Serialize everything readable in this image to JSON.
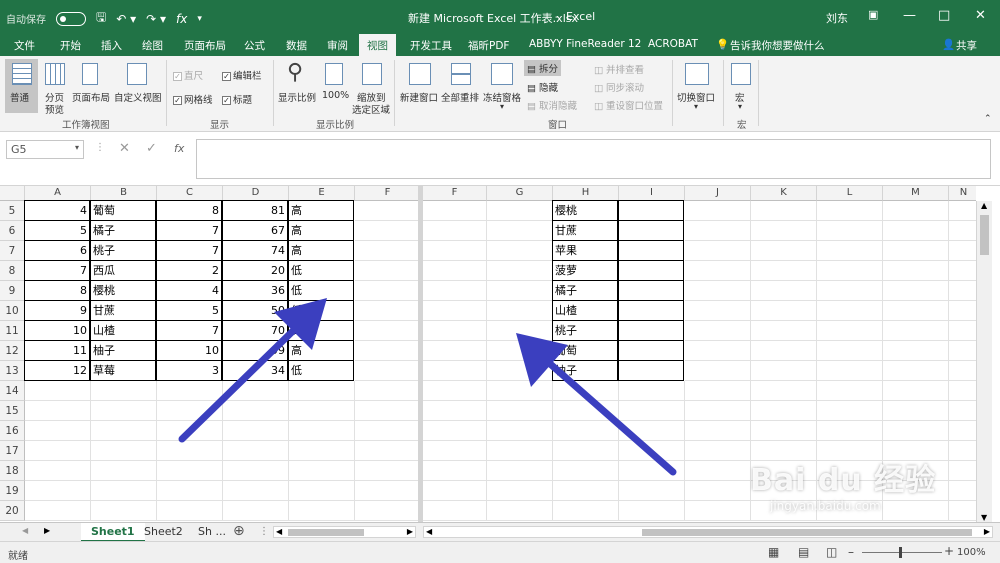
{
  "titlebar": {
    "autosave": "自动保存",
    "filename": "新建 Microsoft Excel 工作表.xlsx",
    "app": "Excel",
    "user": "刘东"
  },
  "tabs": [
    "文件",
    "开始",
    "插入",
    "绘图",
    "页面布局",
    "公式",
    "数据",
    "审阅",
    "视图",
    "开发工具",
    "福昕PDF",
    "ABBYY FineReader 12",
    "ACROBAT",
    "告诉我你想要做什么",
    "共享"
  ],
  "active_tab": "视图",
  "ribbon": {
    "workbook_views": {
      "normal": "普通",
      "page_break": "分页",
      "page_break2": "预览",
      "page_layout": "页面布局",
      "custom": "自定义视图",
      "group": "工作簿视图"
    },
    "show": {
      "ruler": "直尺",
      "formula_bar": "编辑栏",
      "gridlines": "网格线",
      "headings": "标题",
      "group": "显示"
    },
    "zoom": {
      "zoom": "显示比例",
      "hundred": "100%",
      "zoom_sel": "缩放到",
      "zoom_sel2": "选定区域",
      "group": "显示比例"
    },
    "window": {
      "new_window": "新建窗口",
      "arrange_all": "全部重排",
      "freeze": "冻结窗格",
      "split": "拆分",
      "hide": "隐藏",
      "unhide": "取消隐藏",
      "side_by_side": "并排查看",
      "sync_scroll": "同步滚动",
      "reset_pos": "重设窗口位置",
      "switch": "切换窗口",
      "group": "窗口"
    },
    "macros": {
      "macros": "宏",
      "group": "宏"
    }
  },
  "namebox": "G5",
  "left_pane": {
    "columns": [
      "A",
      "B",
      "C",
      "D",
      "E",
      "F"
    ],
    "rows": [
      {
        "n": "5",
        "a": "4",
        "b": "葡萄",
        "c": "8",
        "d": "81",
        "e": "高"
      },
      {
        "n": "6",
        "a": "5",
        "b": "橘子",
        "c": "7",
        "d": "67",
        "e": "高"
      },
      {
        "n": "7",
        "a": "6",
        "b": "桃子",
        "c": "7",
        "d": "74",
        "e": "高"
      },
      {
        "n": "8",
        "a": "7",
        "b": "西瓜",
        "c": "2",
        "d": "20",
        "e": "低"
      },
      {
        "n": "9",
        "a": "8",
        "b": "樱桃",
        "c": "4",
        "d": "36",
        "e": "低"
      },
      {
        "n": "10",
        "a": "9",
        "b": "甘蔗",
        "c": "5",
        "d": "50",
        "e": "低"
      },
      {
        "n": "11",
        "a": "10",
        "b": "山楂",
        "c": "7",
        "d": "70",
        "e": "高"
      },
      {
        "n": "12",
        "a": "11",
        "b": "柚子",
        "c": "10",
        "d": "99",
        "e": "高"
      },
      {
        "n": "13",
        "a": "12",
        "b": "草莓",
        "c": "3",
        "d": "34",
        "e": "低"
      },
      {
        "n": "14"
      },
      {
        "n": "15"
      },
      {
        "n": "16"
      },
      {
        "n": "17"
      },
      {
        "n": "18"
      },
      {
        "n": "19"
      },
      {
        "n": "20"
      }
    ]
  },
  "right_pane": {
    "columns": [
      "F",
      "G",
      "H",
      "I",
      "J",
      "K",
      "L",
      "M",
      "N"
    ],
    "h_values": [
      "樱桃",
      "甘蔗",
      "苹果",
      "菠萝",
      "橘子",
      "山楂",
      "桃子",
      "葡萄",
      "柚子"
    ]
  },
  "sheets": [
    "Sheet1",
    "Sheet2",
    "Sh ..."
  ],
  "status": {
    "ready": "就绪",
    "zoom": "100%"
  },
  "watermark": {
    "logo": "Bai du 经验",
    "url": "jingyan.baidu.com"
  },
  "colors": {
    "accent": "#217346",
    "arrow": "#3b3fbf"
  }
}
